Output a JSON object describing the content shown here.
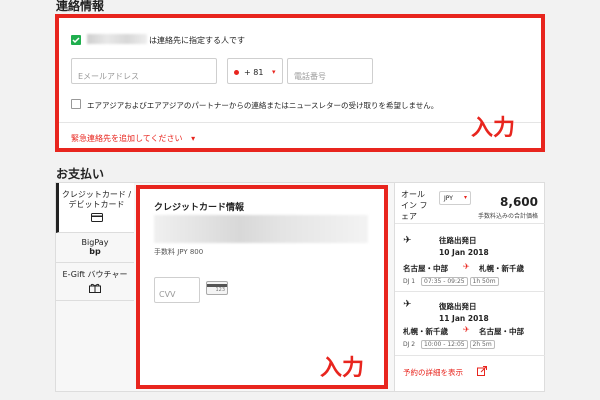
{
  "contact": {
    "section_title": "連絡情報",
    "emergency_designation_label": "は連絡先に指定する人です",
    "email_placeholder": "Eメールアドレス",
    "country_code": "+ 81",
    "phone_placeholder": "電話番号",
    "newsletter_label": "エアアジアおよびエアアジアのパートナーからの連絡またはニュースレターの受け取りを希望しません。",
    "add_emergency_contact": "緊急連絡先を追加してください",
    "annotation": "入力"
  },
  "payment": {
    "section_title": "お支払い",
    "tabs": [
      {
        "label": "クレジットカード / デビットカード",
        "icon": "credit-card-icon"
      },
      {
        "label": "BigPay",
        "icon": "bigpay-icon"
      },
      {
        "label": "E-Gift バウチャー",
        "icon": "gift-icon"
      }
    ],
    "card_info_title": "クレジットカード情報",
    "fee_text": "手数料 JPY 800",
    "cvv_placeholder": "CVV",
    "cvv_hint": "123",
    "annotation": "入力"
  },
  "summary": {
    "all_in_fare": "オールイン フェア",
    "currency": "JPY",
    "total": "8,600",
    "total_caption": "手数料込みの合計価格",
    "outbound": {
      "label": "往路出発日",
      "date": "10 Jan 2018",
      "from": "名古屋・中部",
      "to": "札幌・新千歳",
      "flight": "DJ 1",
      "time": "07:35 - 09:25",
      "duration": "1h 50m"
    },
    "return": {
      "label": "復路出発日",
      "date": "11 Jan 2018",
      "from": "札幌・新千歳",
      "to": "名古屋・中部",
      "flight": "DJ 2",
      "time": "10:00 - 12:05",
      "duration": "2h 5m"
    },
    "details_link": "予約の詳細を表示"
  },
  "colors": {
    "accent": "#e8251e",
    "checkbox": "#1fae4e"
  }
}
